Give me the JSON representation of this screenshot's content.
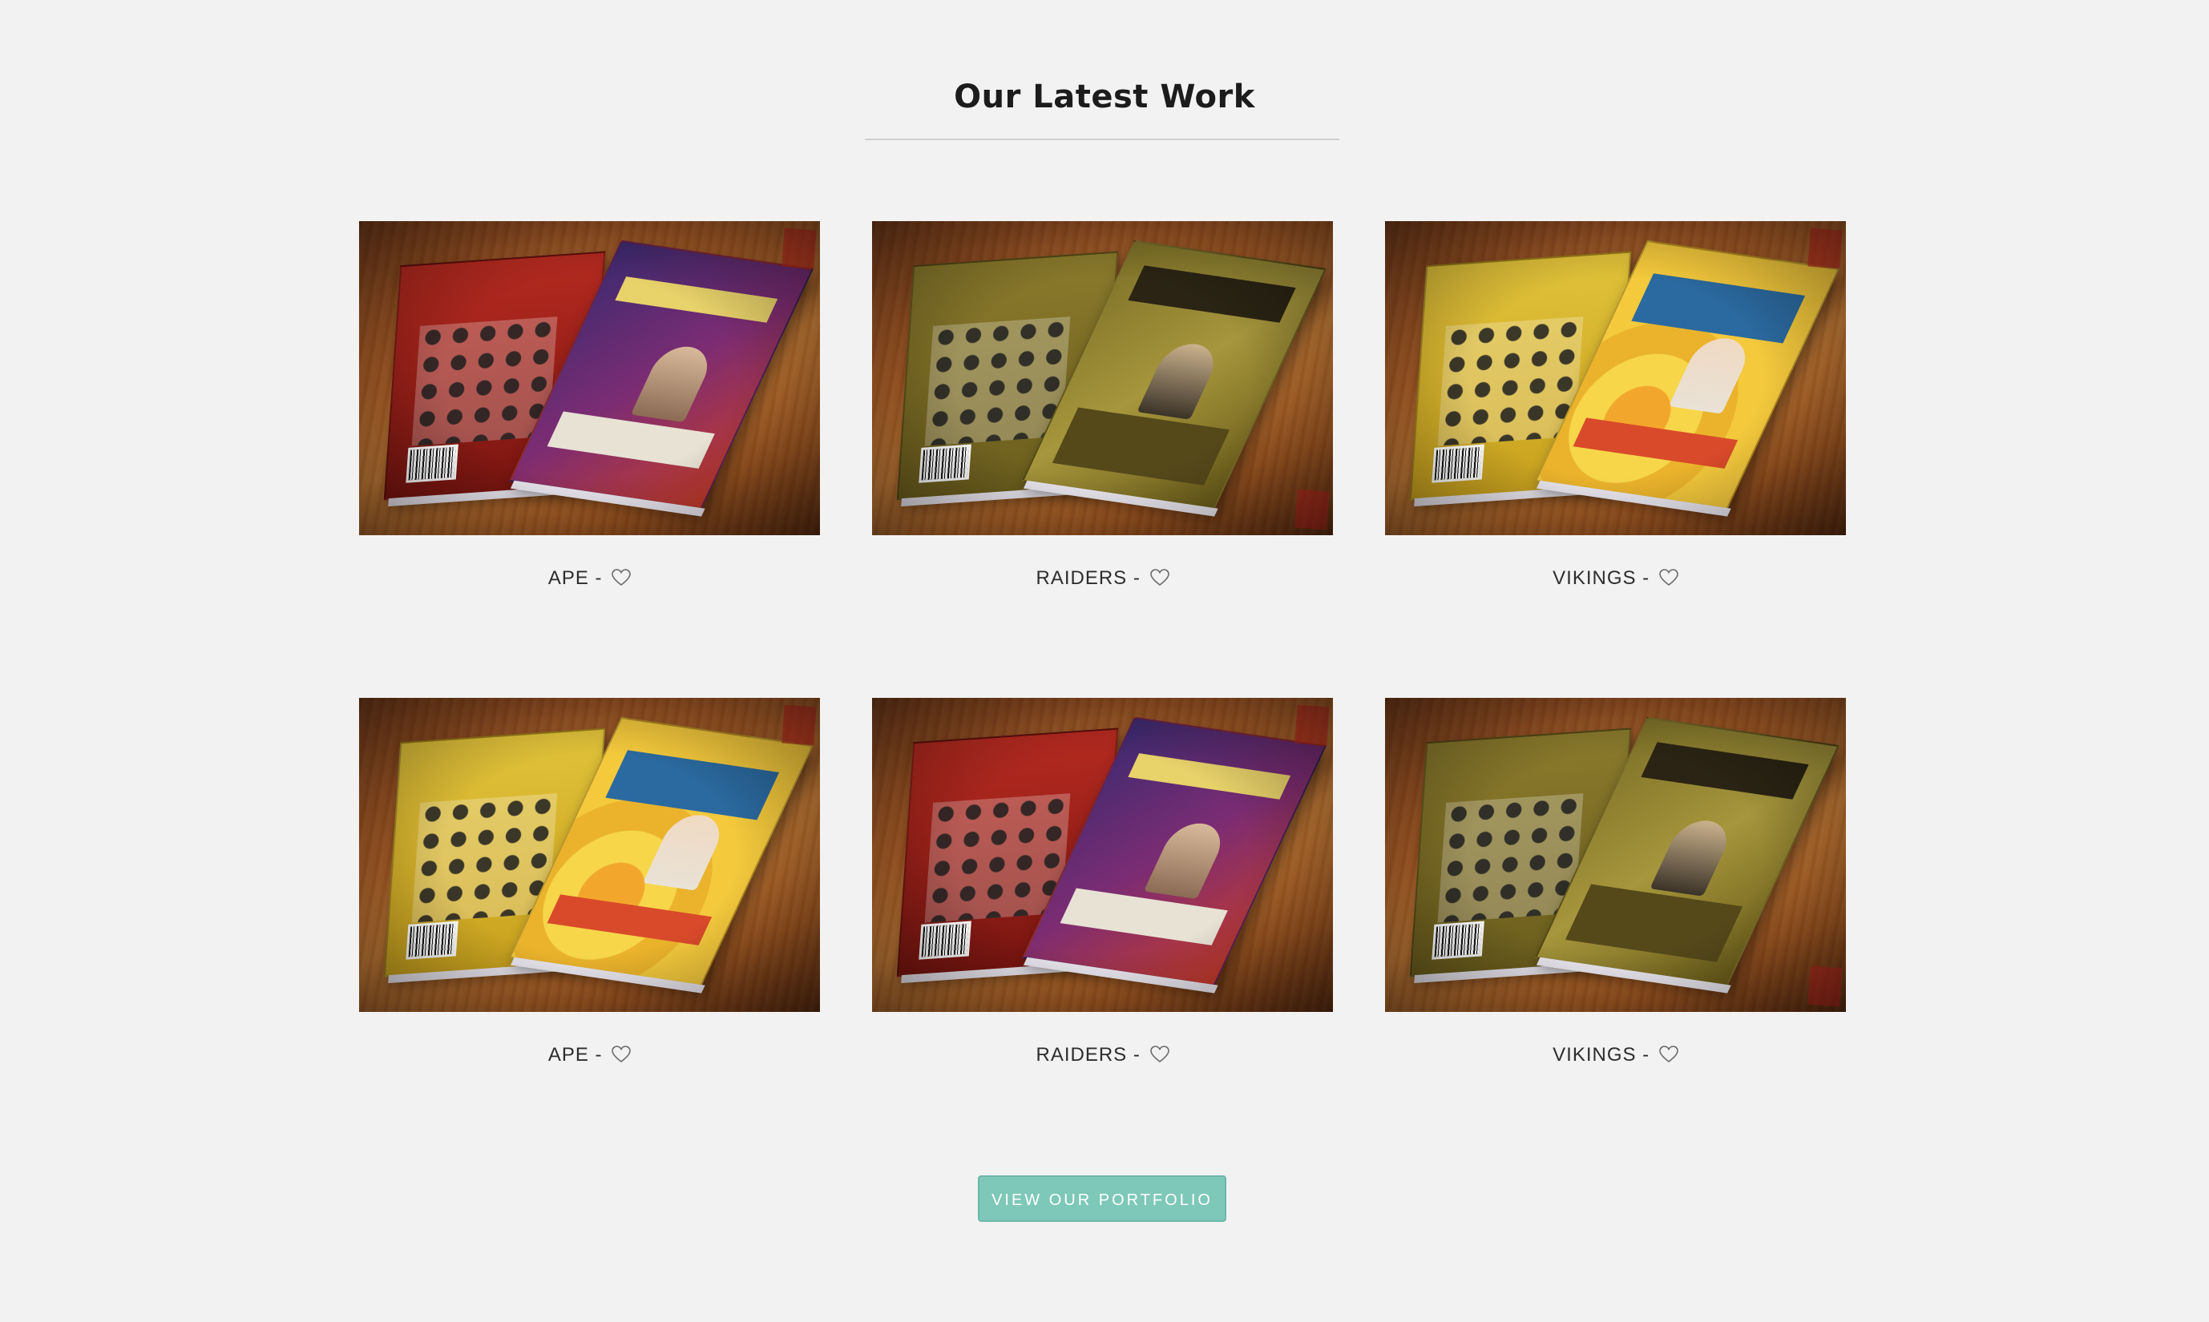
{
  "section": {
    "title": "Our Latest Work"
  },
  "portfolio": {
    "items": [
      {
        "name": "APE",
        "separator": "-",
        "theme": "red",
        "like_icon": "heart-outline-icon"
      },
      {
        "name": "RAIDERS",
        "separator": "-",
        "theme": "olive",
        "like_icon": "heart-outline-icon"
      },
      {
        "name": "VIKINGS",
        "separator": "-",
        "theme": "yellow",
        "like_icon": "heart-outline-icon"
      },
      {
        "name": "APE",
        "separator": "-",
        "theme": "yellow",
        "like_icon": "heart-outline-icon"
      },
      {
        "name": "RAIDERS",
        "separator": "-",
        "theme": "red",
        "like_icon": "heart-outline-icon"
      },
      {
        "name": "VIKINGS",
        "separator": "-",
        "theme": "olive",
        "like_icon": "heart-outline-icon"
      }
    ]
  },
  "cta": {
    "label": "VIEW OUR PORTFOLIO"
  },
  "colors": {
    "background": "#f2f2f2",
    "accent": "#7ec8b9",
    "text": "#2d2d2d"
  }
}
